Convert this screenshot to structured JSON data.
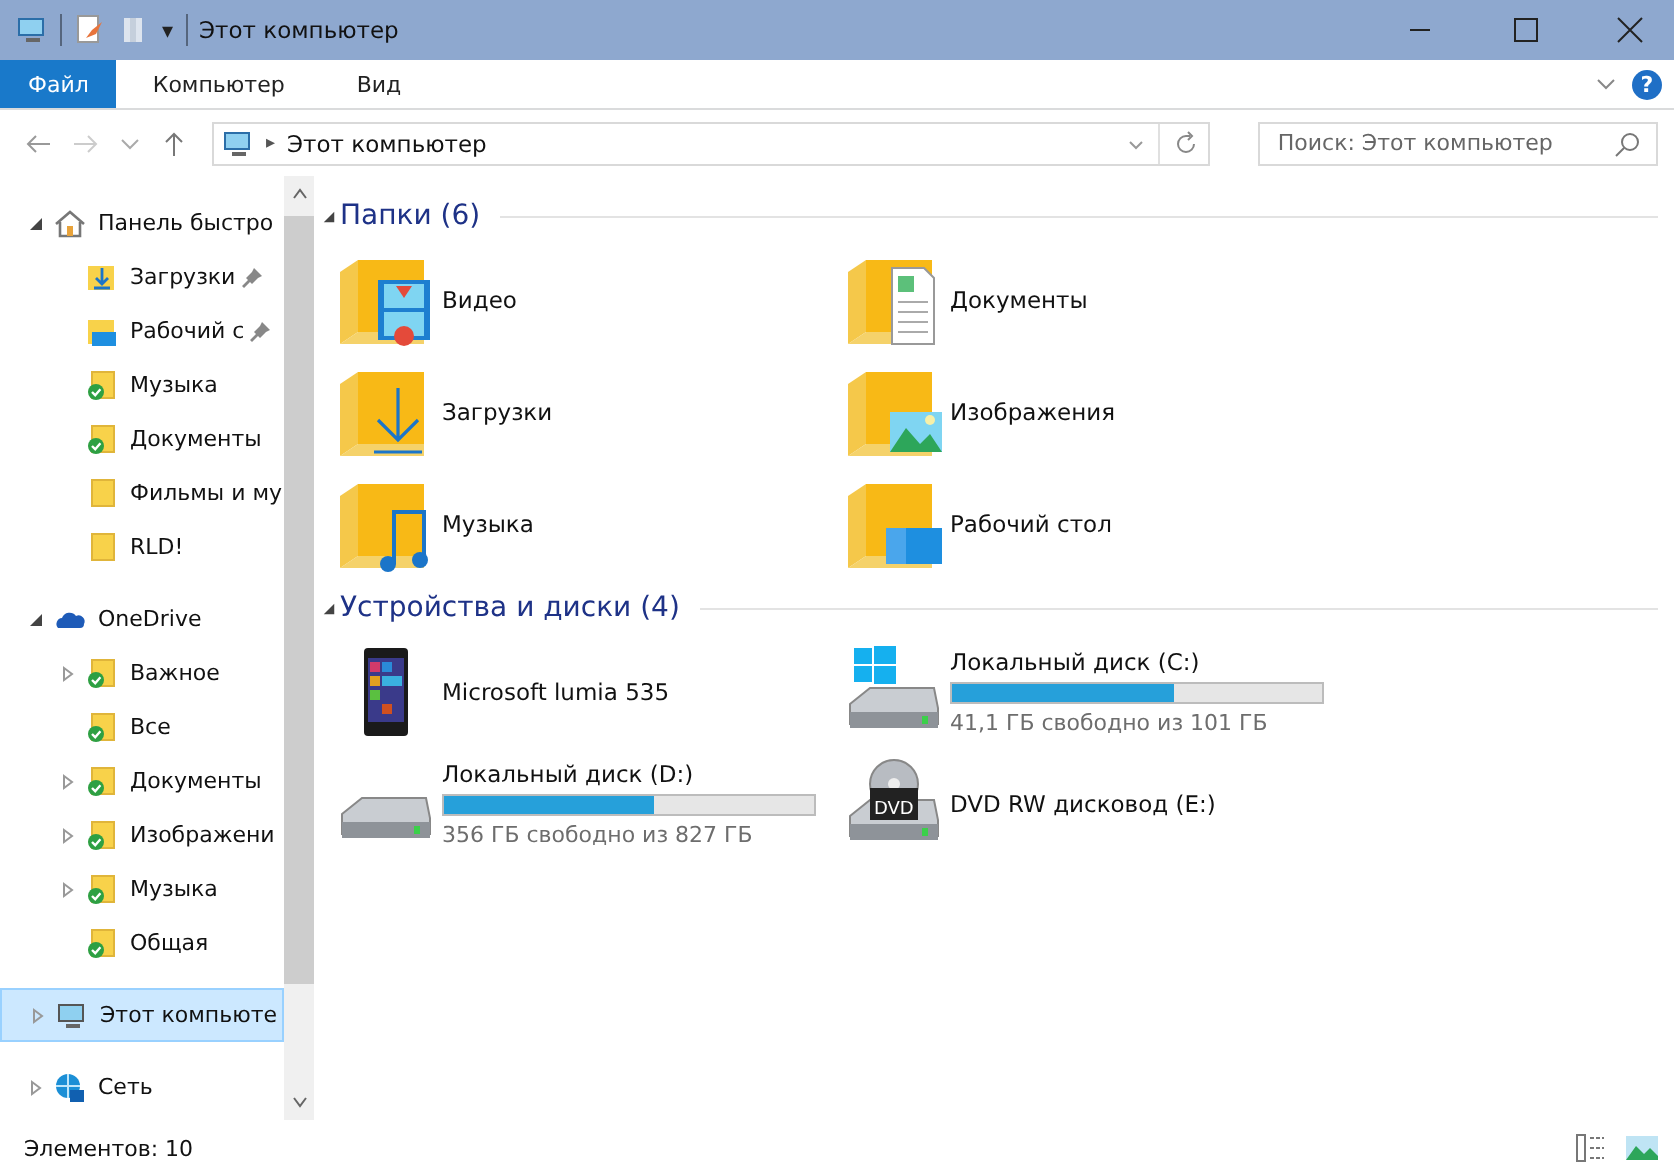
{
  "window": {
    "title": "Этот компьютер",
    "qat_dropdown": "▾"
  },
  "ribbon": {
    "tabs": [
      {
        "label": "Файл",
        "selected": true
      },
      {
        "label": "Компьютер",
        "selected": false
      },
      {
        "label": "Вид",
        "selected": false
      }
    ],
    "help": "?"
  },
  "address": {
    "separator": "▸",
    "path": "Этот компьютер"
  },
  "search": {
    "placeholder": "Поиск: Этот компьютер"
  },
  "sidebar": {
    "items": [
      {
        "label": "Панель быстро",
        "kind": "quick-access",
        "expanded": true,
        "selected": false,
        "children": [
          {
            "label": "Загрузки",
            "kind": "download",
            "pinned": true,
            "selected": false
          },
          {
            "label": "Рабочий с",
            "kind": "desktop",
            "pinned": true,
            "selected": false
          },
          {
            "label": "Музыка",
            "kind": "synced",
            "pinned": false,
            "selected": false
          },
          {
            "label": "Документы",
            "kind": "synced",
            "pinned": false,
            "selected": false
          },
          {
            "label": "Фильмы и му",
            "kind": "folder",
            "pinned": false,
            "selected": false
          },
          {
            "label": "RLD!",
            "kind": "folder",
            "pinned": false,
            "selected": false
          }
        ]
      },
      {
        "label": "OneDrive",
        "kind": "onedrive",
        "expanded": true,
        "selected": false,
        "children": [
          {
            "label": "Важное",
            "kind": "synced",
            "expanded": false,
            "selected": false
          },
          {
            "label": "Все",
            "kind": "synced",
            "selected": false
          },
          {
            "label": "Документы",
            "kind": "synced",
            "expanded": false,
            "selected": false
          },
          {
            "label": "Изображени",
            "kind": "synced",
            "expanded": false,
            "selected": false
          },
          {
            "label": "Музыка",
            "kind": "synced",
            "expanded": false,
            "selected": false
          },
          {
            "label": "Общая",
            "kind": "synced",
            "selected": false
          }
        ]
      },
      {
        "label": "Этот компьюте",
        "kind": "computer",
        "expanded": false,
        "selected": true
      },
      {
        "label": "Сеть",
        "kind": "network",
        "expanded": false,
        "selected": false
      }
    ]
  },
  "groups": [
    {
      "title": "Папки (6)",
      "expanded": true,
      "items": [
        {
          "name": "Видео",
          "kind": "video"
        },
        {
          "name": "Документы",
          "kind": "documents"
        },
        {
          "name": "Загрузки",
          "kind": "downloads"
        },
        {
          "name": "Изображения",
          "kind": "pictures"
        },
        {
          "name": "Музыка",
          "kind": "music"
        },
        {
          "name": "Рабочий стол",
          "kind": "desktop"
        }
      ]
    },
    {
      "title": "Устройства и диски (4)",
      "expanded": true,
      "items": [
        {
          "name": "Microsoft lumia 535",
          "kind": "phone"
        },
        {
          "name": "Локальный диск (C:)",
          "kind": "system-drive",
          "level": 0.6,
          "free": "41,1 ГБ свободно из 101 ГБ"
        },
        {
          "name": "Локальный диск (D:)",
          "kind": "drive",
          "level": 0.57,
          "free": "356 ГБ свободно из 827 ГБ"
        },
        {
          "name": "DVD RW дисковод (E:)",
          "kind": "dvd",
          "dvd_label": "DVD"
        }
      ]
    }
  ],
  "status_bar": {
    "count": "Элементов: 10"
  }
}
